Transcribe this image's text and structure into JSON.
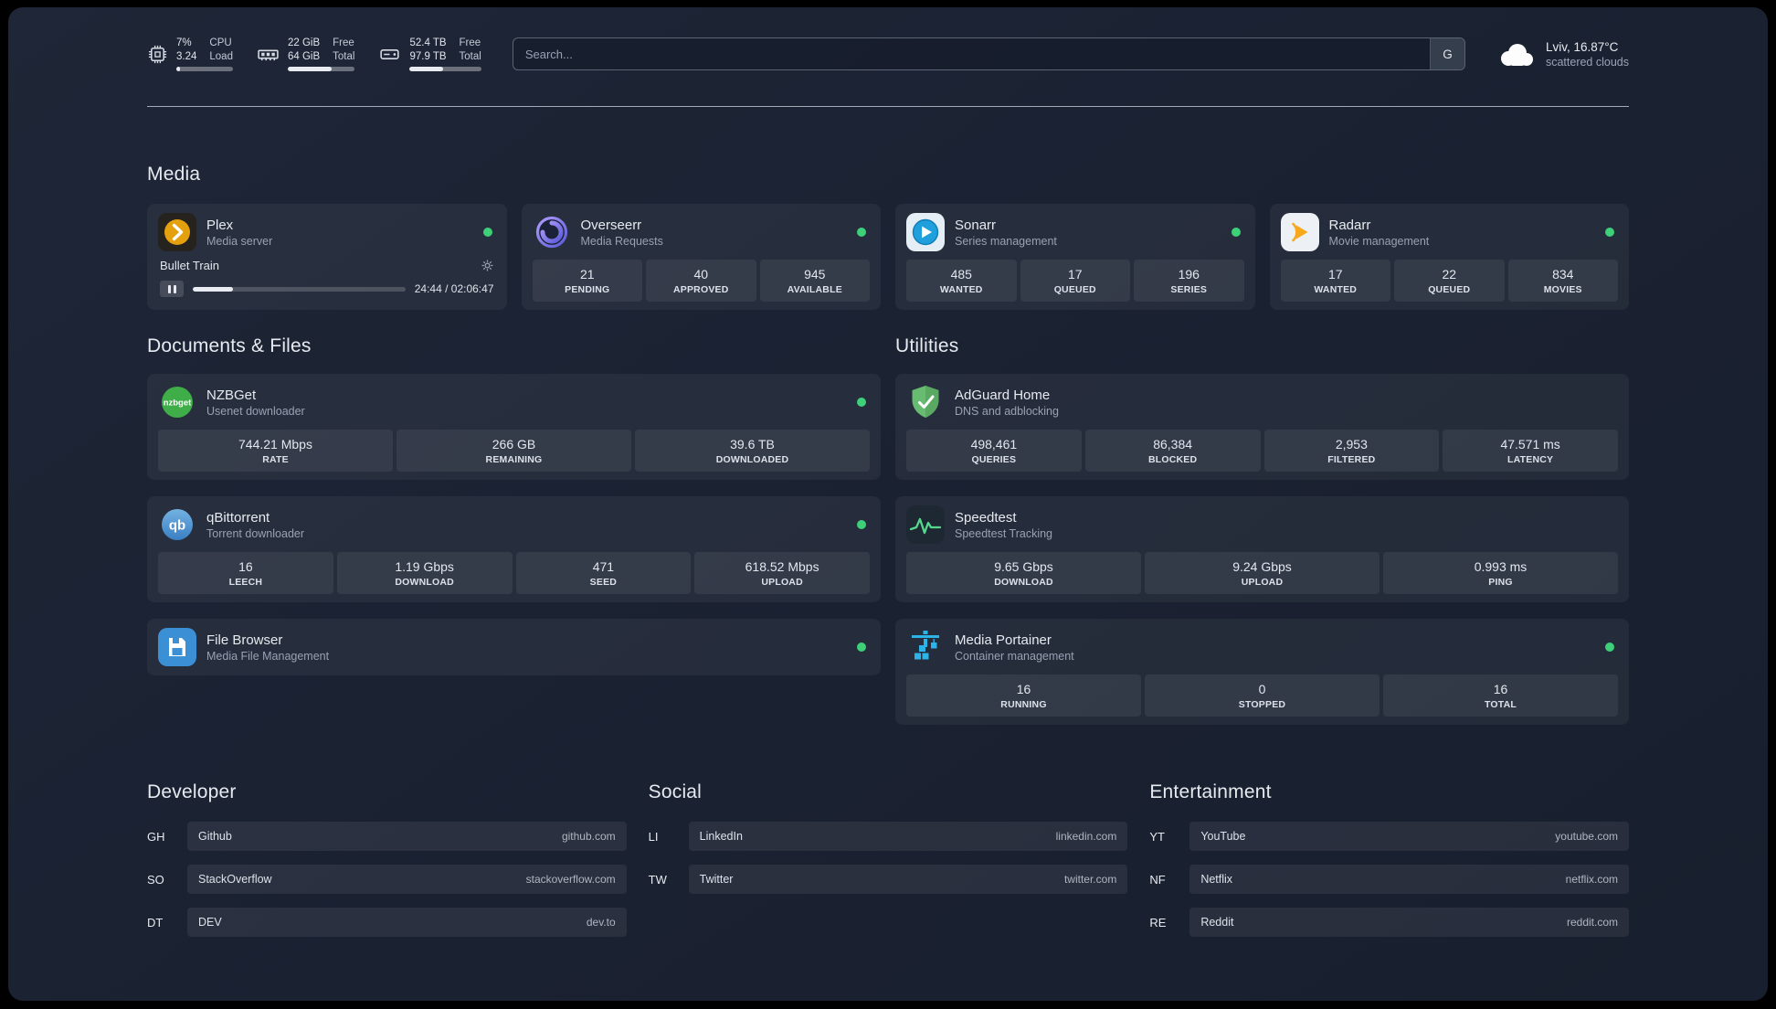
{
  "colors": {
    "status-online": "#3ecf79",
    "accent-bar": "#e8ecf2"
  },
  "topbar": {
    "cpu": {
      "icon": "cpu-icon",
      "values": [
        "7%",
        "3.24"
      ],
      "labels": [
        "CPU",
        "Load"
      ],
      "progress": 7
    },
    "memory": {
      "icon": "memory-icon",
      "values": [
        "22 GiB",
        "64 GiB"
      ],
      "labels": [
        "Free",
        "Total"
      ],
      "progress": 66
    },
    "disk": {
      "icon": "disk-icon",
      "values": [
        "52.4 TB",
        "97.9 TB"
      ],
      "labels": [
        "Free",
        "Total"
      ],
      "progress": 46
    },
    "search": {
      "placeholder": "Search...",
      "provider_label": "G"
    },
    "weather": {
      "icon": "cloud-icon",
      "location": "Lviv, 16.87°C",
      "condition": "scattered clouds"
    }
  },
  "media": {
    "title": "Media",
    "cards": [
      {
        "name": "Plex",
        "subtitle": "Media server",
        "online": true,
        "icon": "plex-icon",
        "now_playing": {
          "title": "Bullet Train",
          "time": "24:44 / 02:06:47",
          "progress": 19
        }
      },
      {
        "name": "Overseerr",
        "subtitle": "Media Requests",
        "online": true,
        "icon": "overseerr-icon",
        "stats": [
          {
            "value": "21",
            "label": "PENDING"
          },
          {
            "value": "40",
            "label": "APPROVED"
          },
          {
            "value": "945",
            "label": "AVAILABLE"
          }
        ]
      },
      {
        "name": "Sonarr",
        "subtitle": "Series management",
        "online": true,
        "icon": "sonarr-icon",
        "stats": [
          {
            "value": "485",
            "label": "WANTED"
          },
          {
            "value": "17",
            "label": "QUEUED"
          },
          {
            "value": "196",
            "label": "SERIES"
          }
        ]
      },
      {
        "name": "Radarr",
        "subtitle": "Movie management",
        "online": true,
        "icon": "radarr-icon",
        "stats": [
          {
            "value": "17",
            "label": "WANTED"
          },
          {
            "value": "22",
            "label": "QUEUED"
          },
          {
            "value": "834",
            "label": "MOVIES"
          }
        ]
      }
    ]
  },
  "documents": {
    "title": "Documents & Files",
    "cards": [
      {
        "name": "NZBGet",
        "subtitle": "Usenet downloader",
        "online": true,
        "icon": "nzbget-icon",
        "stats": [
          {
            "value": "744.21 Mbps",
            "label": "RATE"
          },
          {
            "value": "266 GB",
            "label": "REMAINING"
          },
          {
            "value": "39.6 TB",
            "label": "DOWNLOADED"
          }
        ]
      },
      {
        "name": "qBittorrent",
        "subtitle": "Torrent downloader",
        "online": true,
        "icon": "qbittorrent-icon",
        "stats": [
          {
            "value": "16",
            "label": "LEECH"
          },
          {
            "value": "1.19 Gbps",
            "label": "DOWNLOAD"
          },
          {
            "value": "471",
            "label": "SEED"
          },
          {
            "value": "618.52 Mbps",
            "label": "UPLOAD"
          }
        ]
      },
      {
        "name": "File Browser",
        "subtitle": "Media File Management",
        "online": true,
        "icon": "filebrowser-icon"
      }
    ]
  },
  "utilities": {
    "title": "Utilities",
    "cards": [
      {
        "name": "AdGuard Home",
        "subtitle": "DNS and adblocking",
        "icon": "adguard-icon",
        "stats": [
          {
            "value": "498,461",
            "label": "QUERIES"
          },
          {
            "value": "86,384",
            "label": "BLOCKED"
          },
          {
            "value": "2,953",
            "label": "FILTERED"
          },
          {
            "value": "47.571 ms",
            "label": "LATENCY"
          }
        ]
      },
      {
        "name": "Speedtest",
        "subtitle": "Speedtest Tracking",
        "icon": "speedtest-icon",
        "stats": [
          {
            "value": "9.65 Gbps",
            "label": "DOWNLOAD"
          },
          {
            "value": "9.24 Gbps",
            "label": "UPLOAD"
          },
          {
            "value": "0.993 ms",
            "label": "PING"
          }
        ]
      },
      {
        "name": "Media Portainer",
        "subtitle": "Container management",
        "online": true,
        "icon": "portainer-icon",
        "stats": [
          {
            "value": "16",
            "label": "RUNNING"
          },
          {
            "value": "0",
            "label": "STOPPED"
          },
          {
            "value": "16",
            "label": "TOTAL"
          }
        ]
      }
    ]
  },
  "bookmarks": [
    {
      "title": "Developer",
      "items": [
        {
          "abbr": "GH",
          "name": "Github",
          "url": "github.com"
        },
        {
          "abbr": "SO",
          "name": "StackOverflow",
          "url": "stackoverflow.com"
        },
        {
          "abbr": "DT",
          "name": "DEV",
          "url": "dev.to"
        }
      ]
    },
    {
      "title": "Social",
      "items": [
        {
          "abbr": "LI",
          "name": "LinkedIn",
          "url": "linkedin.com"
        },
        {
          "abbr": "TW",
          "name": "Twitter",
          "url": "twitter.com"
        }
      ]
    },
    {
      "title": "Entertainment",
      "items": [
        {
          "abbr": "YT",
          "name": "YouTube",
          "url": "youtube.com"
        },
        {
          "abbr": "NF",
          "name": "Netflix",
          "url": "netflix.com"
        },
        {
          "abbr": "RE",
          "name": "Reddit",
          "url": "reddit.com"
        }
      ]
    }
  ]
}
